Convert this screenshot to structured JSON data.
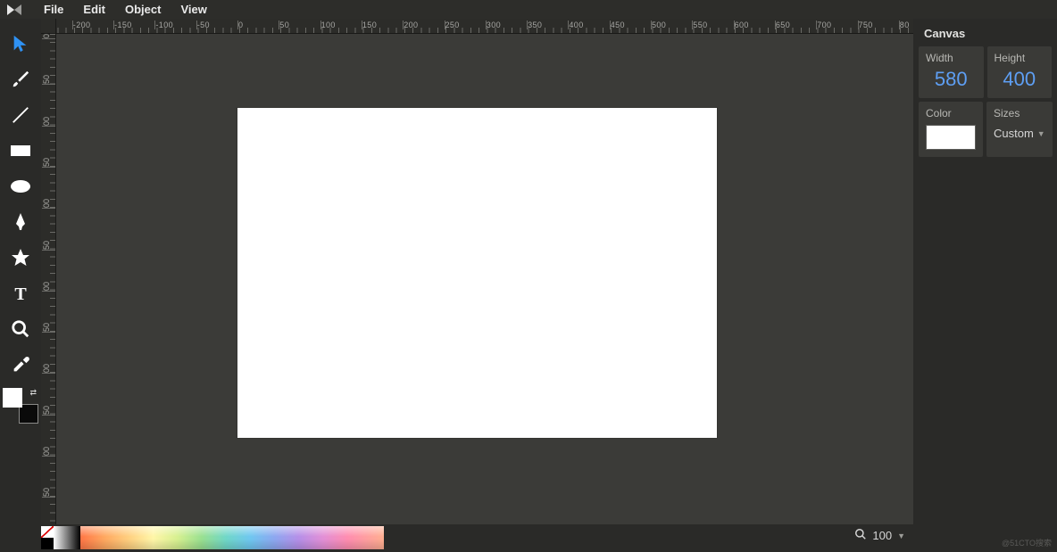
{
  "menubar": {
    "items": [
      "File",
      "Edit",
      "Object",
      "View"
    ]
  },
  "tools": [
    {
      "name": "select-tool",
      "active": true
    },
    {
      "name": "brush-tool",
      "active": false
    },
    {
      "name": "line-tool",
      "active": false
    },
    {
      "name": "rectangle-tool",
      "active": false
    },
    {
      "name": "ellipse-tool",
      "active": false
    },
    {
      "name": "pen-tool",
      "active": false
    },
    {
      "name": "star-tool",
      "active": false
    },
    {
      "name": "text-tool",
      "active": false
    },
    {
      "name": "zoom-tool",
      "active": false
    },
    {
      "name": "eyedropper-tool",
      "active": false
    }
  ],
  "ruler": {
    "h_labels": [
      "-200",
      "-150",
      "-100",
      "-50",
      "0",
      "50",
      "100",
      "150",
      "200",
      "250",
      "300",
      "350",
      "400",
      "450",
      "500",
      "550",
      "600",
      "650",
      "700",
      "750",
      "80"
    ],
    "v_labels": [
      "0",
      "50",
      "00",
      "50",
      "00",
      "50",
      "00",
      "50",
      "00",
      "50",
      "00",
      "50"
    ]
  },
  "canvas": {
    "panel_title": "Canvas",
    "width_label": "Width",
    "width_value": "580",
    "height_label": "Height",
    "height_value": "400",
    "color_label": "Color",
    "color_value": "#FFFFFF",
    "sizes_label": "Sizes",
    "sizes_value": "Custom"
  },
  "footer": {
    "zoom_value": "100"
  },
  "watermark": "@51CTO搜索"
}
